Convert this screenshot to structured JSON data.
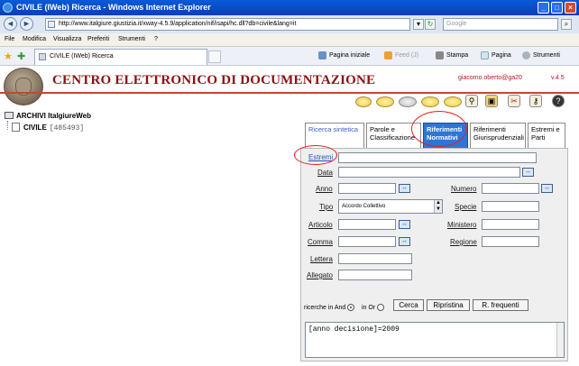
{
  "window": {
    "title": "CIVILE (IWeb) Ricerca - Windows Internet Explorer",
    "minimize": "_",
    "maximize": "□",
    "close": "×"
  },
  "address": {
    "back": "◄",
    "forward": "►",
    "url": "http://www.italgiure.giustizia.it/xway-4.5.9/application/nif/isapi/hc.dll?db=civile&lang=it",
    "search_placeholder": "Google"
  },
  "menu": [
    "File",
    "Modifica",
    "Visualizza",
    "Preferiti",
    "Strumenti",
    "?"
  ],
  "tabbar": {
    "tab_title": "CIVILE (IWeb) Ricerca",
    "home": "Pagina iniziale",
    "feed": "Feed (J)",
    "print": "Stampa",
    "page": "Pagina",
    "tools": "Strumenti"
  },
  "header": {
    "banner": "CENTRO ELETTRONICO DI DOCUMENTAZIONE",
    "user": "giacomo.oberto@ga20",
    "version": "v.4.5"
  },
  "toolbar_icons": [
    "oval-yellow-1",
    "oval-yellow-2",
    "oval-gray-striped",
    "oval-yellow-3",
    "oval-yellow-4",
    "binoculars-icon",
    "bag-icon",
    "scissors-icon",
    "help-icon"
  ],
  "tree": {
    "root": "ARCHIVI ItalgiureWeb",
    "child": "CIVILE",
    "count": "[485493]"
  },
  "search_tabs": [
    {
      "label": "Ricerca sintetica"
    },
    {
      "label": "Parole e Classificazione"
    },
    {
      "label": "Riferimenti Normativi"
    },
    {
      "label": "Riferimenti Giurisprudenziali"
    },
    {
      "label": "Estremi e Parti"
    }
  ],
  "form": {
    "estremi": "Estremi",
    "data": "Data",
    "anno": "Anno",
    "numero": "Numero",
    "tipo": "Tipo",
    "tipo_value": "Accordo Collettivo",
    "specie": "Specie",
    "articolo": "Articolo",
    "ministero": "Ministero",
    "comma": "Comma",
    "regione": "Regione",
    "lettera": "Lettera",
    "allegato": "Allegato",
    "plus": "↔"
  },
  "controls": {
    "ricerche_and": "ricerche in And",
    "or": "in Or",
    "cerca": "Cerca",
    "ripristina": "Ripristina",
    "frequenti": "R. frequenti",
    "query": "[anno decisione]=2009"
  }
}
